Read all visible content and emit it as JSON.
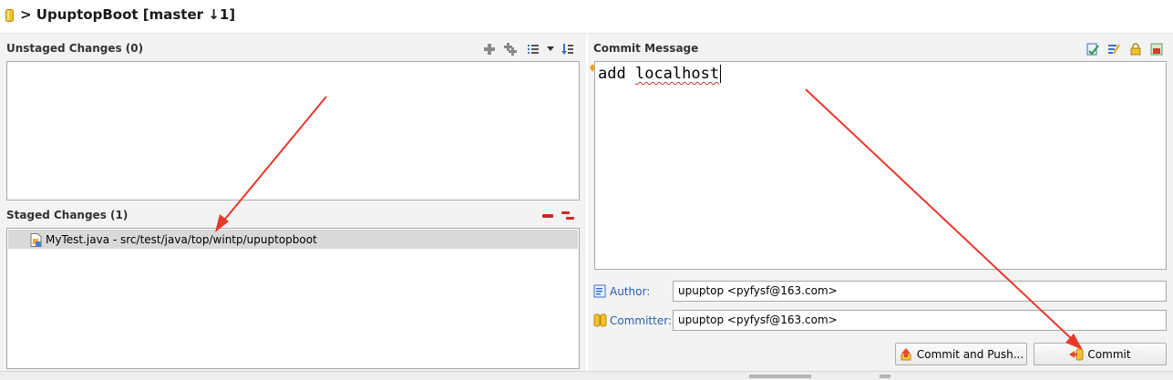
{
  "title": "> UpuptopBoot [master ↓1]",
  "unstaged": {
    "header": "Unstaged Changes (0)"
  },
  "staged": {
    "header": "Staged Changes (1)",
    "files": [
      {
        "label": "MyTest.java - src/test/java/top/wintp/upuptopboot",
        "icon": "java-file-icon"
      }
    ]
  },
  "commit": {
    "header": "Commit Message",
    "message_word1": "add",
    "message_word2": "localhost",
    "author_label": "Author:",
    "author_value": "upuptop <pyfysf@163.com>",
    "committer_label": "Committer:",
    "committer_value": "upuptop <pyfysf@163.com>",
    "commit_push_label": "Commit and Push...",
    "commit_label": "Commit"
  },
  "colors": {
    "arrow": "#e8382c",
    "link_label": "#2a5db0",
    "panel_bg": "#f3f3f3"
  }
}
